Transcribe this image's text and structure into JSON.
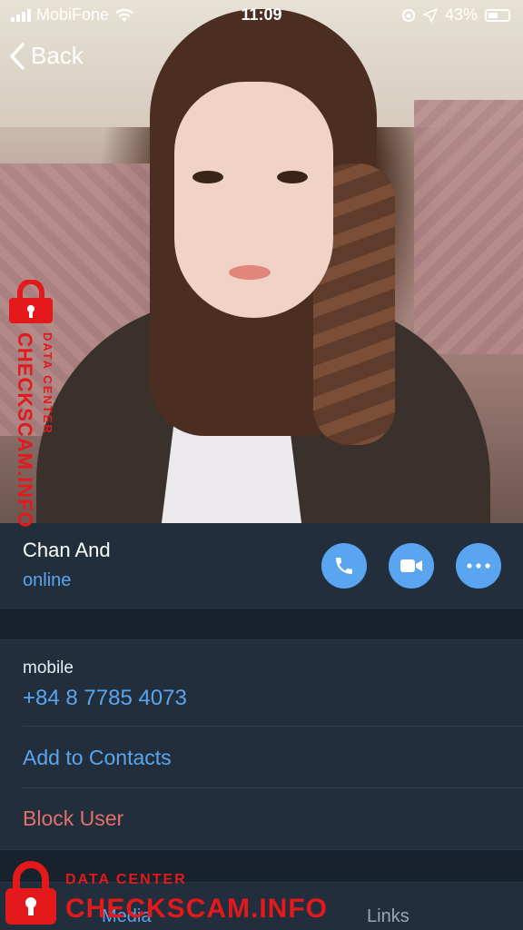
{
  "status_bar": {
    "carrier": "MobiFone",
    "time": "11:09",
    "battery": "43%",
    "battery_level": 0.43
  },
  "nav": {
    "back_label": "Back"
  },
  "profile": {
    "name": "Chan And",
    "status": "online",
    "actions": [
      "phone-icon",
      "video-camera-icon",
      "more-icon"
    ]
  },
  "details": {
    "phone_label": "mobile",
    "phone_number": "+84 8 7785 4073",
    "add_contacts": "Add to Contacts",
    "block_user": "Block User"
  },
  "tabs": {
    "media": "Media",
    "links": "Links"
  },
  "watermark": {
    "site": "CHECKSCAM.INFO",
    "subtitle": "DATA CENTER"
  },
  "colors": {
    "accent": "#5aa5f0",
    "danger": "#e0716c",
    "panel": "#222e3b",
    "background": "#18222d",
    "watermark": "#e3191b"
  }
}
